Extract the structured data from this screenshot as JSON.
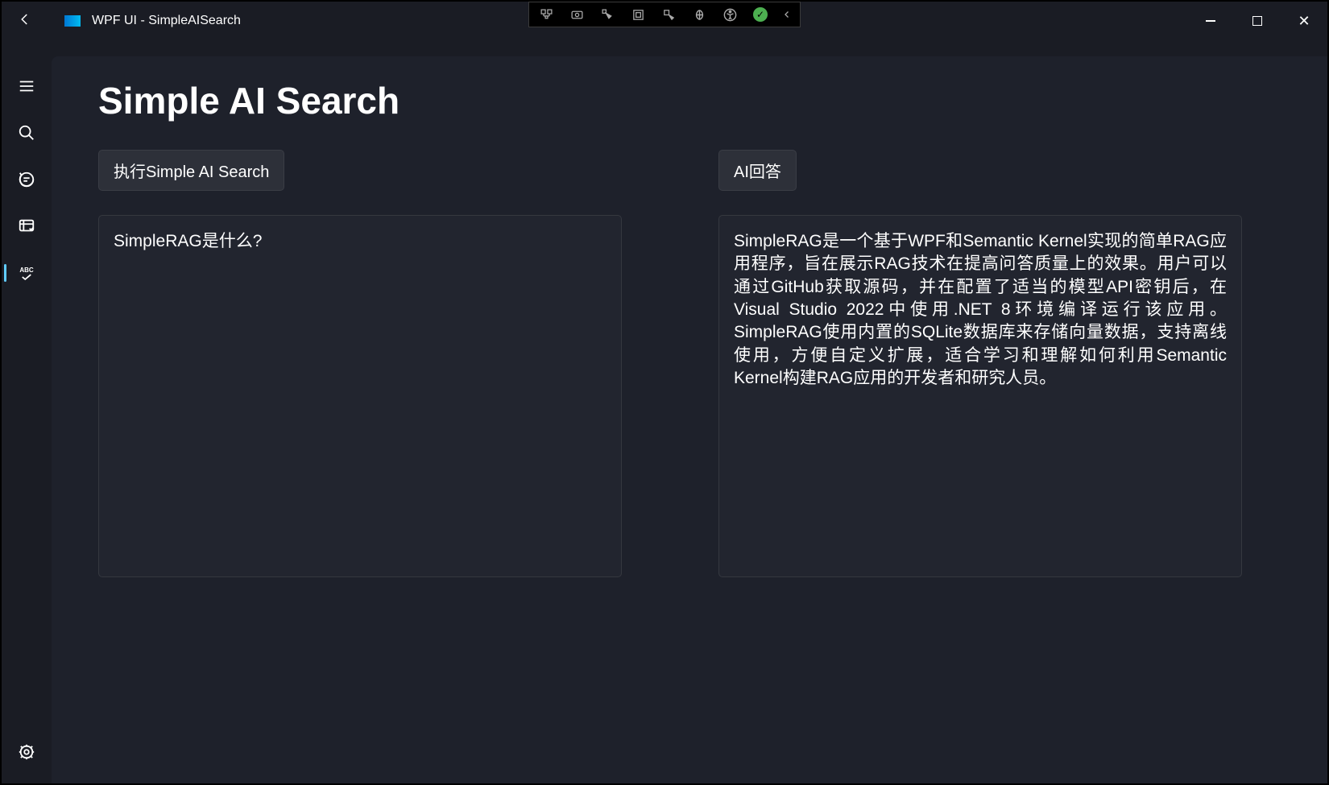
{
  "window": {
    "title": "WPF UI - SimpleAISearch"
  },
  "page": {
    "title": "Simple AI Search"
  },
  "left_panel": {
    "button_label": "执行Simple AI Search",
    "input_text": "SimpleRAG是什么?"
  },
  "right_panel": {
    "button_label": "AI回答",
    "output_text": "SimpleRAG是一个基于WPF和Semantic Kernel实现的简单RAG应用程序，旨在展示RAG技术在提高问答质量上的效果。用户可以通过GitHub获取源码，并在配置了适当的模型API密钥后，在Visual Studio 2022中使用.NET 8环境编译运行该应用。SimpleRAG使用内置的SQLite数据库来存储向量数据，支持离线使用，方便自定义扩展，适合学习和理解如何利用Semantic Kernel构建RAG应用的开发者和研究人员。"
  },
  "sidebar": {
    "items": [
      {
        "name": "hamburger"
      },
      {
        "name": "search"
      },
      {
        "name": "chat"
      },
      {
        "name": "data"
      },
      {
        "name": "abc-check"
      }
    ],
    "settings_label": "settings"
  }
}
